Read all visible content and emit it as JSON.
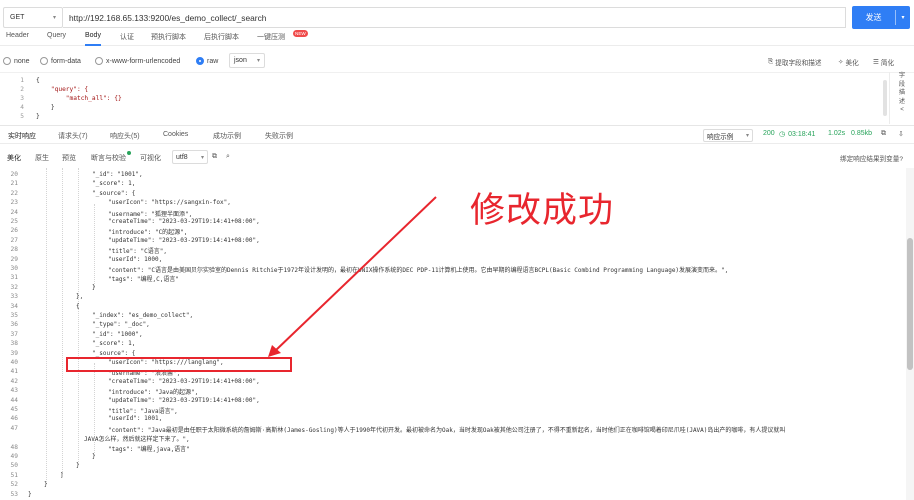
{
  "request": {
    "method": "GET",
    "url": "http://192.168.65.133:9200/es_demo_collect/_search",
    "send_label": "发送"
  },
  "req_tabs": [
    {
      "label": "Header"
    },
    {
      "label": "Query"
    },
    {
      "label": "Body"
    },
    {
      "label": "认证"
    },
    {
      "label": "预执行脚本"
    },
    {
      "label": "后执行脚本"
    },
    {
      "label": "一键压测"
    }
  ],
  "new_badge": "NEW",
  "body_types": [
    {
      "label": "none"
    },
    {
      "label": "form-data"
    },
    {
      "label": "x-www-form-urlencoded"
    },
    {
      "label": "raw"
    }
  ],
  "raw_format": "json",
  "body_tools": {
    "extract": "提取字段和描述",
    "beautify": "美化",
    "simplify": "简化"
  },
  "side_label": [
    "字",
    "段",
    "描",
    "述",
    "<"
  ],
  "request_body": {
    "line_numbers": [
      "1",
      "2",
      "3",
      "4",
      "5"
    ],
    "lines": [
      "{",
      "    \"query\": {",
      "        \"match_all\": {}",
      "    }",
      "}"
    ]
  },
  "resp_tabs": [
    {
      "label": "实时响应"
    },
    {
      "label": "请求头(7)"
    },
    {
      "label": "响应头(5)"
    },
    {
      "label": "Cookies"
    },
    {
      "label": "成功示例"
    },
    {
      "label": "失败示例"
    }
  ],
  "resp_meta": {
    "example_select": "响应示例",
    "status": "200",
    "time": "03:18:41",
    "duration": "1.02s",
    "size": "0.85kb"
  },
  "view_tabs": [
    {
      "label": "美化"
    },
    {
      "label": "原生"
    },
    {
      "label": "预览"
    },
    {
      "label": "断言与校验"
    },
    {
      "label": "可视化"
    }
  ],
  "encoding": "utf8",
  "bind_example": "绑定响应结果到变量?",
  "annotation_text": "修改成功",
  "response_lines": [
    {
      "n": "20",
      "t": "\"_id\": \"1001\","
    },
    {
      "n": "21",
      "t": "\"_score\": 1,"
    },
    {
      "n": "22",
      "t": "\"_source\": {"
    },
    {
      "n": "23",
      "t": "\"userIcon\": \"https://sangxin-fox\","
    },
    {
      "n": "24",
      "t": "\"username\": \"狐狸半面添\","
    },
    {
      "n": "25",
      "t": "\"createTime\": \"2023-03-29T19:14:41+08:00\","
    },
    {
      "n": "26",
      "t": "\"introduce\": \"C的起源\","
    },
    {
      "n": "27",
      "t": "\"updateTime\": \"2023-03-29T19:14:41+08:00\","
    },
    {
      "n": "28",
      "t": "\"title\": \"C语言\","
    },
    {
      "n": "29",
      "t": "\"userId\": 1000,"
    },
    {
      "n": "30",
      "t": "\"content\": \"C语言是由美国贝尔实验室的Dennis Ritchie于1972年设计发明的，最初在UNIX操作系统的DEC PDP-11计算机上使用。它由早期的编程语言BCPL(Basic Combind Programming Language)发展演变而来。\","
    },
    {
      "n": "31",
      "t": "\"tags\": \"编程,C,语言\""
    },
    {
      "n": "32",
      "t": "}"
    },
    {
      "n": "33",
      "t": "},"
    },
    {
      "n": "34",
      "t": "{"
    },
    {
      "n": "35",
      "t": "\"_index\": \"es_demo_collect\","
    },
    {
      "n": "36",
      "t": "\"_type\": \"_doc\","
    },
    {
      "n": "37",
      "t": "\"_id\": \"1000\","
    },
    {
      "n": "38",
      "t": "\"_score\": 1,"
    },
    {
      "n": "39",
      "t": "\"_source\": {"
    },
    {
      "n": "40",
      "t": "\"userIcon\": \"https:///langlang\","
    },
    {
      "n": "41",
      "t": "\"username\": \"浪浪酱\","
    },
    {
      "n": "42",
      "t": "\"createTime\": \"2023-03-29T19:14:41+08:00\","
    },
    {
      "n": "43",
      "t": "\"introduce\": \"Java的起源\","
    },
    {
      "n": "44",
      "t": "\"updateTime\": \"2023-03-29T19:14:41+08:00\","
    },
    {
      "n": "45",
      "t": "\"title\": \"Java语言\","
    },
    {
      "n": "46",
      "t": "\"userId\": 1001,"
    },
    {
      "n": "47",
      "t": "\"content\": \"Java最初是由任职于太阳微系统的詹姆斯·高斯林(James-Gosling)等人于1990年代初开发。最初被命名为Oak，当时发现Oak被其他公司注册了，不得不重新起名，当时他们正在咖啡馆喝着印尼爪哇(JAVA)岛出产的咖啡，有人提议就叫"
    },
    {
      "n": "",
      "t": "JAVA怎么样，然后就这样定下来了。\","
    },
    {
      "n": "48",
      "t": "\"tags\": \"编程,java,语言\""
    },
    {
      "n": "49",
      "t": "}"
    },
    {
      "n": "50",
      "t": "}"
    },
    {
      "n": "51",
      "t": "]"
    },
    {
      "n": "52",
      "t": "}"
    },
    {
      "n": "53",
      "t": "}"
    }
  ]
}
